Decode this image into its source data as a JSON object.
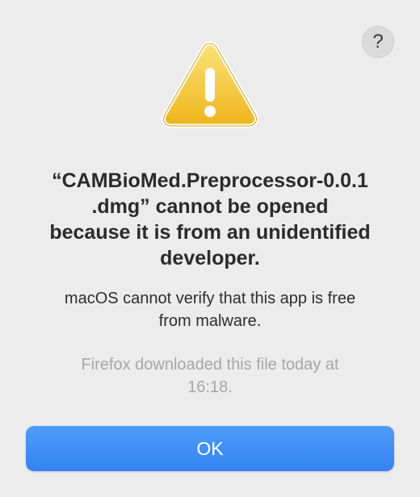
{
  "dialog": {
    "help_label": "?",
    "icon": "warning-triangle-icon",
    "title_lines": [
      "“CAMBioMed.Preprocessor-0.0.1",
      ".dmg” cannot be opened",
      "because it is from an unidentified",
      "developer."
    ],
    "message_lines": [
      "macOS cannot verify that this app is free",
      "from malware."
    ],
    "info_lines": [
      "Firefox downloaded this file today at",
      "16:18."
    ],
    "ok_label": "OK"
  },
  "colors": {
    "background": "#ececec",
    "accent": "#3b8af5",
    "warning": "#f5c518"
  }
}
